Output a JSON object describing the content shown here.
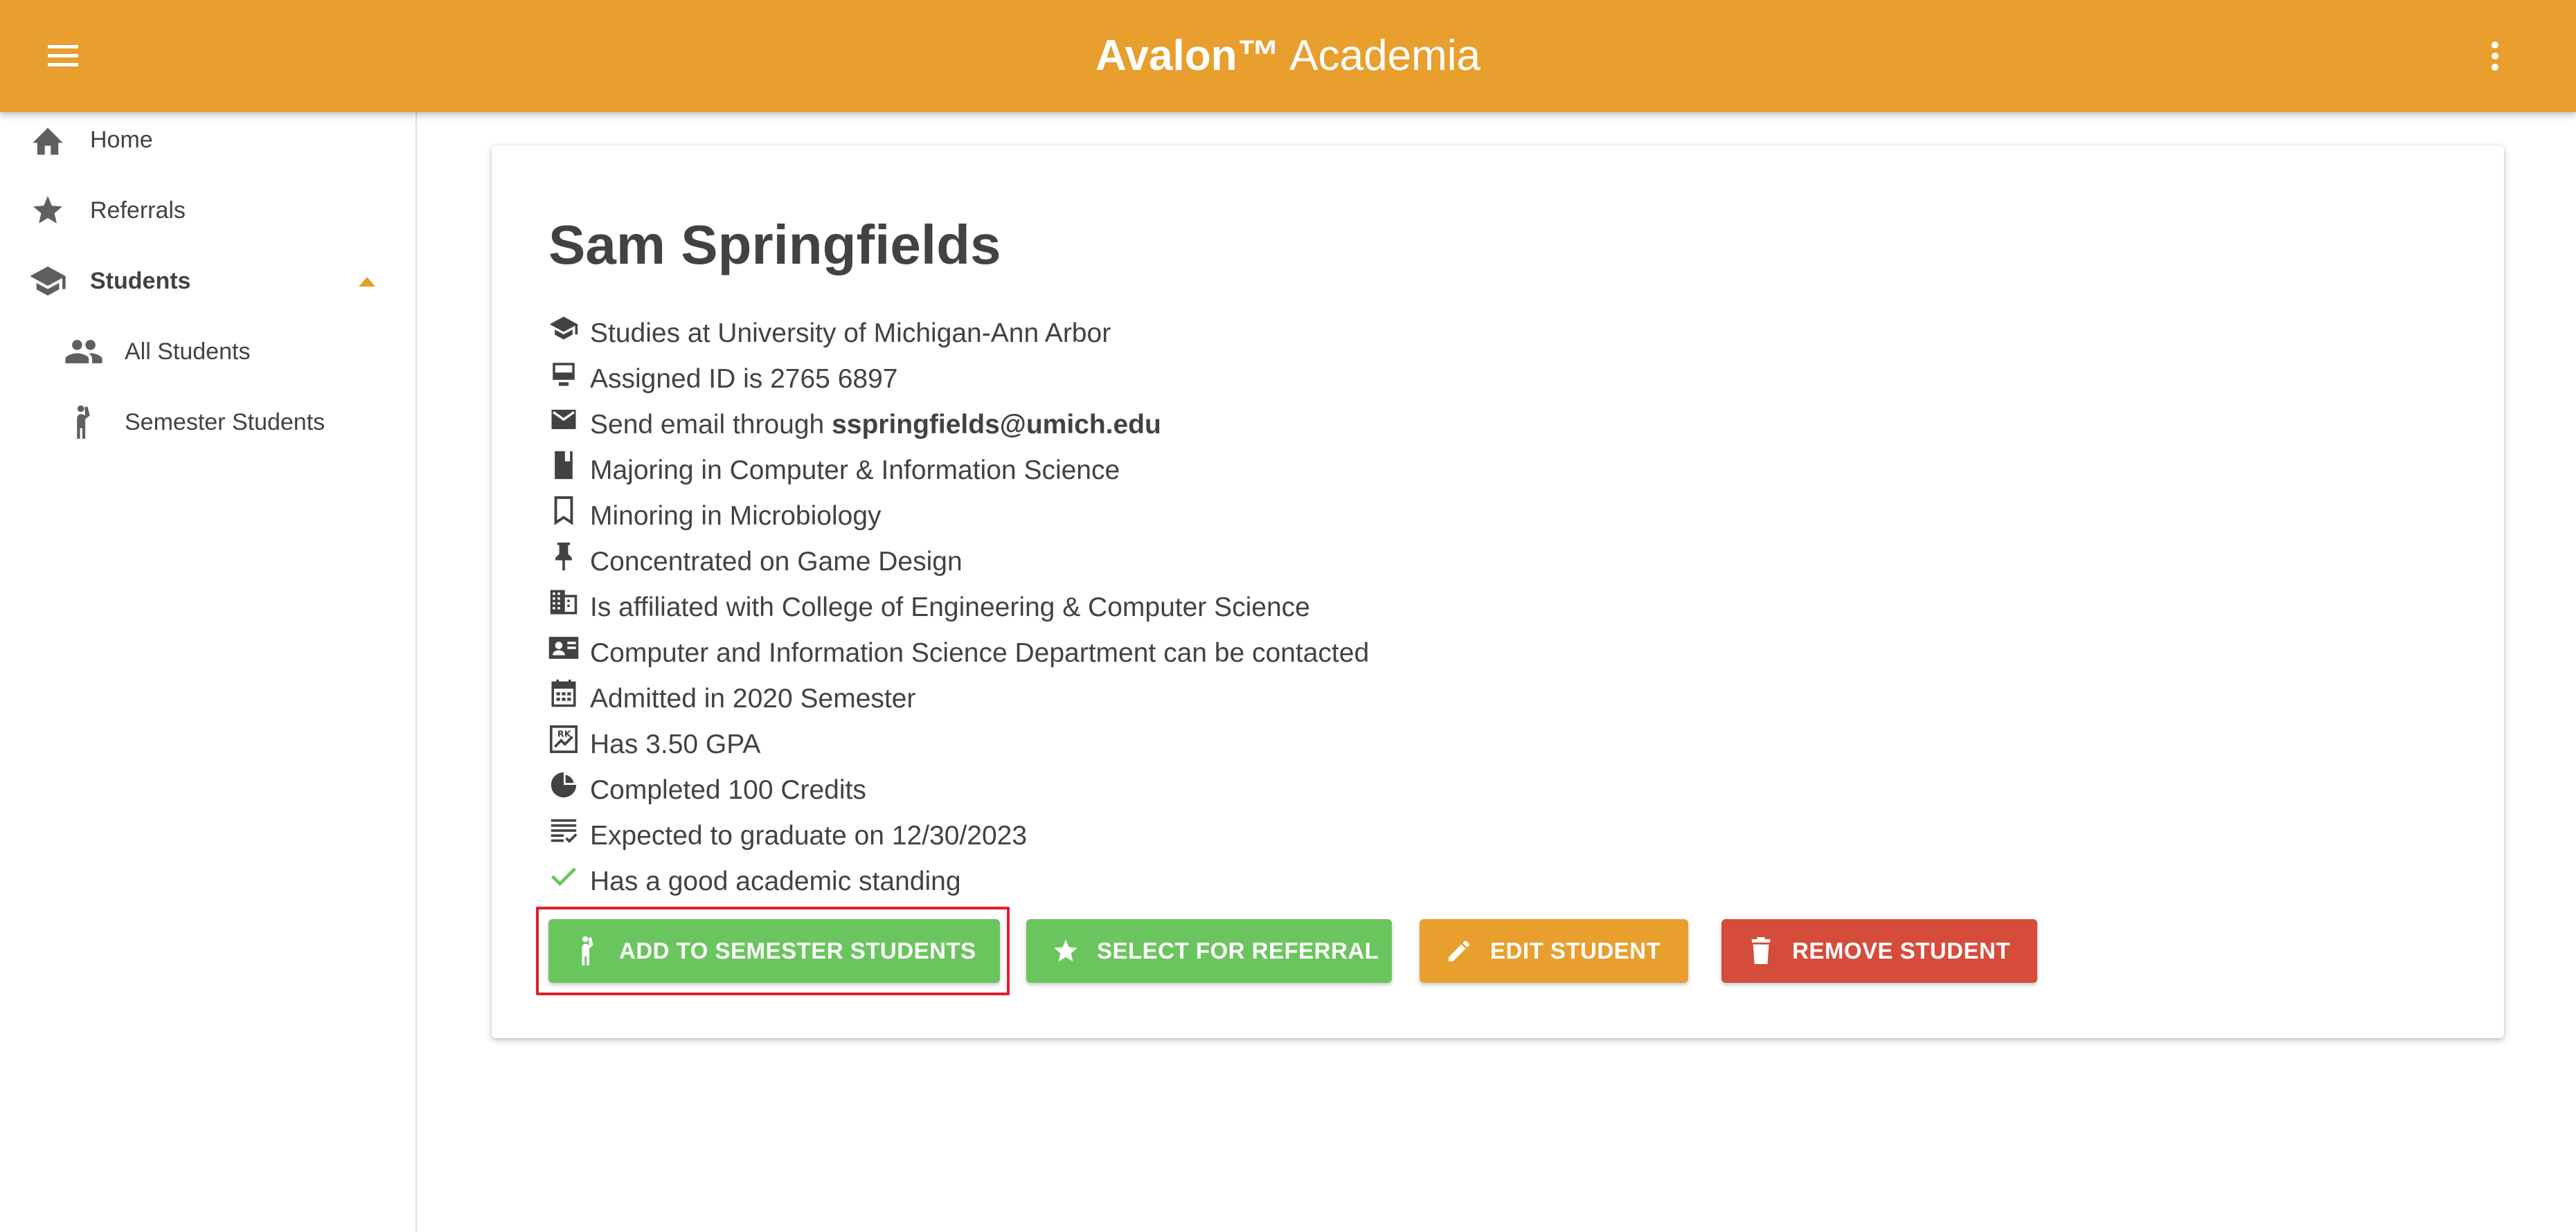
{
  "header": {
    "brand_bold": "Avalon™",
    "brand_rest": "Academia",
    "menu_icon": "menu-icon",
    "more_icon": "more-vert-icon",
    "color": "#E89F2E"
  },
  "sidebar": {
    "items": [
      {
        "label": "Home",
        "icon": "home-icon"
      },
      {
        "label": "Referrals",
        "icon": "star-icon"
      },
      {
        "label": "Students",
        "icon": "school-icon",
        "expanded": true
      },
      {
        "label": "All Students",
        "icon": "people-icon"
      },
      {
        "label": "Semester Students",
        "icon": "hail-icon"
      }
    ]
  },
  "student": {
    "name": "Sam Springfields",
    "details": [
      {
        "icon": "school-icon",
        "text": "Studies at University of Michigan-Ann Arbor"
      },
      {
        "icon": "badge-icon",
        "text": "Assigned ID is 2765 6897"
      },
      {
        "icon": "email-icon",
        "text_prefix": "Send email through ",
        "email": "sspringfields@umich.edu"
      },
      {
        "icon": "book-icon",
        "text": "Majoring in Computer & Information Science"
      },
      {
        "icon": "bookmark-icon",
        "text": "Minoring in Microbiology"
      },
      {
        "icon": "pin-icon",
        "text": "Concentrated on Game Design"
      },
      {
        "icon": "domain-icon",
        "text": "Is affiliated with College of Engineering & Computer Science"
      },
      {
        "icon": "contact-mail-icon",
        "text": "Computer and Information Science Department can be contacted"
      },
      {
        "icon": "calendar-icon",
        "text": "Admitted in 2020 Semester"
      },
      {
        "icon": "grade-chart-icon",
        "text": "Has 3.50 GPA"
      },
      {
        "icon": "pie-chart-icon",
        "text": "Completed 100 Credits"
      },
      {
        "icon": "checklist-icon",
        "text": "Expected to graduate on 12/30/2023"
      },
      {
        "icon": "check-icon",
        "text": "Has a good academic standing"
      }
    ]
  },
  "actions": {
    "add_semester": "ADD TO SEMESTER STUDENTS",
    "select_referral": "SELECT FOR REFERRAL",
    "edit": "EDIT STUDENT",
    "remove": "REMOVE STUDENT",
    "colors": {
      "green": "#6BC55E",
      "orange": "#E89F2E",
      "red": "#D64C3A",
      "highlight": "#E0202A"
    }
  }
}
